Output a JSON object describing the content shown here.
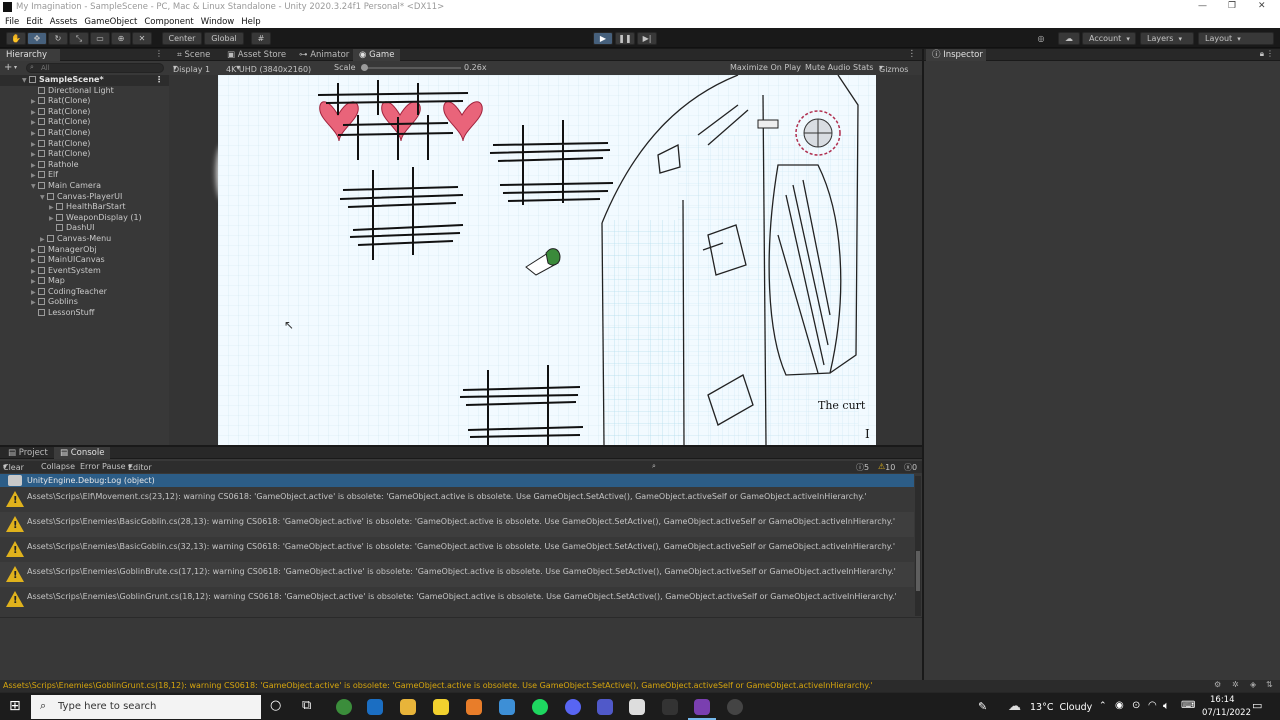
{
  "window": {
    "title": "My Imagination - SampleScene - PC, Mac & Linux Standalone - Unity 2020.3.24f1 Personal* <DX11>"
  },
  "menu": [
    "File",
    "Edit",
    "Assets",
    "GameObject",
    "Component",
    "Window",
    "Help"
  ],
  "toolbar": {
    "pivot": "Center",
    "space": "Global",
    "account": "Account",
    "layers": "Layers",
    "layout": "Layout"
  },
  "hierarchy": {
    "tab": "Hierarchy",
    "search_placeholder": "All",
    "items": [
      {
        "label": "SampleScene*",
        "depth": 0,
        "arrow": "▼",
        "scene": true
      },
      {
        "label": "Directional Light",
        "depth": 1,
        "arrow": ""
      },
      {
        "label": "Rat(Clone)",
        "depth": 1,
        "arrow": "▶"
      },
      {
        "label": "Rat(Clone)",
        "depth": 1,
        "arrow": "▶"
      },
      {
        "label": "Rat(Clone)",
        "depth": 1,
        "arrow": "▶"
      },
      {
        "label": "Rat(Clone)",
        "depth": 1,
        "arrow": "▶"
      },
      {
        "label": "Rat(Clone)",
        "depth": 1,
        "arrow": "▶"
      },
      {
        "label": "Rat(Clone)",
        "depth": 1,
        "arrow": "▶"
      },
      {
        "label": "Rathole",
        "depth": 1,
        "arrow": "▶"
      },
      {
        "label": "Elf",
        "depth": 1,
        "arrow": "▶"
      },
      {
        "label": "Main Camera",
        "depth": 1,
        "arrow": "▼"
      },
      {
        "label": "Canvas-PlayerUI",
        "depth": 2,
        "arrow": "▼"
      },
      {
        "label": "HealthBarStart",
        "depth": 3,
        "arrow": "▶"
      },
      {
        "label": "WeaponDisplay (1)",
        "depth": 3,
        "arrow": "▶"
      },
      {
        "label": "DashUI",
        "depth": 3,
        "arrow": ""
      },
      {
        "label": "Canvas-Menu",
        "depth": 2,
        "arrow": "▶"
      },
      {
        "label": "ManagerObj",
        "depth": 1,
        "arrow": "▶"
      },
      {
        "label": "MainUICanvas",
        "depth": 1,
        "arrow": "▶"
      },
      {
        "label": "EventSystem",
        "depth": 1,
        "arrow": "▶"
      },
      {
        "label": "Map",
        "depth": 1,
        "arrow": "▶"
      },
      {
        "label": "CodingTeacher",
        "depth": 1,
        "arrow": "▶"
      },
      {
        "label": "Goblins",
        "depth": 1,
        "arrow": "▶"
      },
      {
        "label": "LessonStuff",
        "depth": 1,
        "arrow": ""
      }
    ]
  },
  "view_tabs": [
    "Scene",
    "Asset Store",
    "Animator",
    "Game"
  ],
  "game_bar": {
    "display": "Display 1",
    "resolution": "4K UHD (3840x2160)",
    "scale_label": "Scale",
    "scale_value": "0.26x",
    "maximize": "Maximize On Play",
    "mute": "Mute Audio",
    "stats": "Stats",
    "gizmos": "Gizmos"
  },
  "game_text": {
    "sign": "The curt",
    "cursor_letter": "I"
  },
  "inspector": {
    "tab": "Inspector"
  },
  "bottom_tabs": [
    "Project",
    "Console"
  ],
  "console_bar": {
    "clear": "Clear",
    "collapse": "Collapse",
    "error_pause": "Error Pause",
    "editor": "Editor",
    "log_count": "5",
    "warn_count": "10",
    "error_count": "0"
  },
  "console": {
    "selected": "UnityEngine.Debug:Log (object)",
    "warnings": [
      "Assets\\Scrips\\Elf\\Movement.cs(23,12): warning CS0618: 'GameObject.active' is obsolete: 'GameObject.active is obsolete. Use GameObject.SetActive(), GameObject.activeSelf or GameObject.activeInHierarchy.'",
      "Assets\\Scrips\\Enemies\\BasicGoblin.cs(28,13): warning CS0618: 'GameObject.active' is obsolete: 'GameObject.active is obsolete. Use GameObject.SetActive(), GameObject.activeSelf or GameObject.activeInHierarchy.'",
      "Assets\\Scrips\\Enemies\\BasicGoblin.cs(32,13): warning CS0618: 'GameObject.active' is obsolete: 'GameObject.active is obsolete. Use GameObject.SetActive(), GameObject.activeSelf or GameObject.activeInHierarchy.'",
      "Assets\\Scrips\\Enemies\\GoblinBrute.cs(17,12): warning CS0618: 'GameObject.active' is obsolete: 'GameObject.active is obsolete. Use GameObject.SetActive(), GameObject.activeSelf or GameObject.activeInHierarchy.'",
      "Assets\\Scrips\\Enemies\\GoblinGrunt.cs(18,12): warning CS0618: 'GameObject.active' is obsolete: 'GameObject.active is obsolete. Use GameObject.SetActive(), GameObject.activeSelf or GameObject.activeInHierarchy.'"
    ]
  },
  "status_bar": {
    "message": "Assets\\Scrips\\Enemies\\GoblinGrunt.cs(18,12): warning CS0618: 'GameObject.active' is obsolete: 'GameObject.active is obsolete. Use GameObject.SetActive(), GameObject.activeSelf or GameObject.activeInHierarchy.'"
  },
  "taskbar": {
    "search_placeholder": "Type here to search",
    "weather": "13°C  Cloudy",
    "time": "16:14",
    "date": "07/11/2022"
  },
  "colors": {
    "accent": "#3a79bb",
    "warning": "#e0b21c",
    "panel": "#383838"
  }
}
